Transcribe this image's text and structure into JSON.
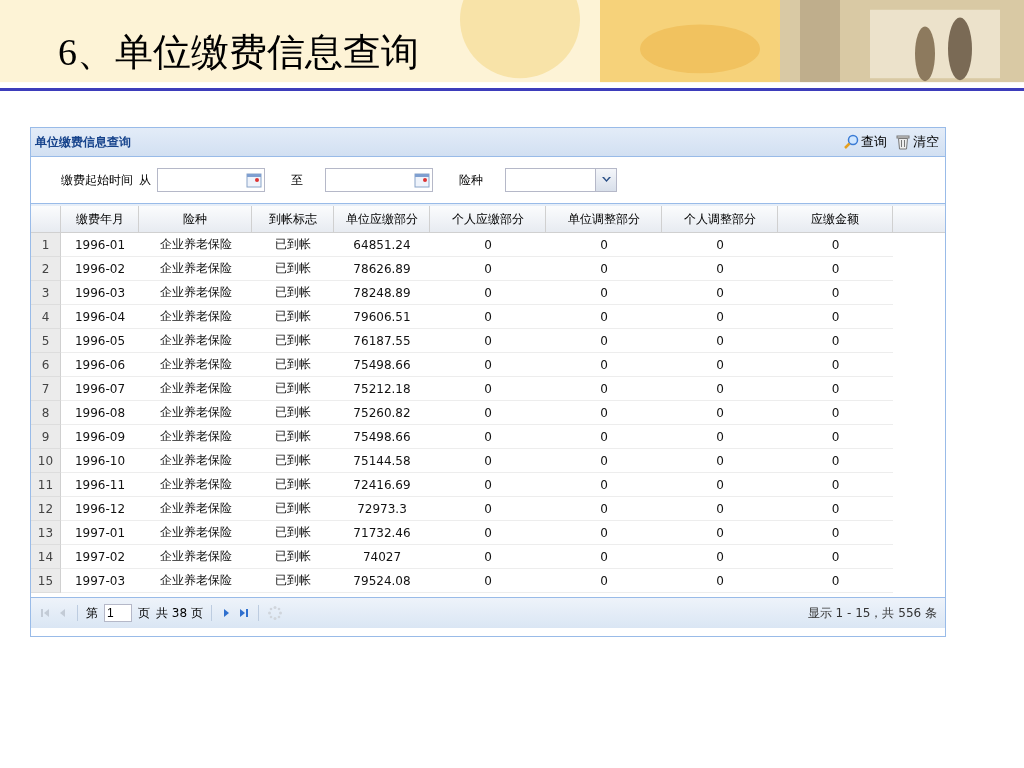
{
  "slide_title": "6、单位缴费信息查询",
  "panel": {
    "title": "单位缴费信息查询",
    "actions": [
      {
        "kind": "search",
        "label": "查询"
      },
      {
        "kind": "clear",
        "label": "清空"
      }
    ]
  },
  "filters": {
    "period_label": "缴费起始时间",
    "from_label": "从",
    "to_label": "至",
    "insurance_label": "险种"
  },
  "table": {
    "columns": [
      "",
      "缴费年月",
      "险种",
      "到帐标志",
      "单位应缴部分",
      "个人应缴部分",
      "单位调整部分",
      "个人调整部分",
      "应缴金额"
    ],
    "rows": [
      [
        "1",
        "1996-01",
        "企业养老保险",
        "已到帐",
        "64851.24",
        "0",
        "0",
        "0",
        "0"
      ],
      [
        "2",
        "1996-02",
        "企业养老保险",
        "已到帐",
        "78626.89",
        "0",
        "0",
        "0",
        "0"
      ],
      [
        "3",
        "1996-03",
        "企业养老保险",
        "已到帐",
        "78248.89",
        "0",
        "0",
        "0",
        "0"
      ],
      [
        "4",
        "1996-04",
        "企业养老保险",
        "已到帐",
        "79606.51",
        "0",
        "0",
        "0",
        "0"
      ],
      [
        "5",
        "1996-05",
        "企业养老保险",
        "已到帐",
        "76187.55",
        "0",
        "0",
        "0",
        "0"
      ],
      [
        "6",
        "1996-06",
        "企业养老保险",
        "已到帐",
        "75498.66",
        "0",
        "0",
        "0",
        "0"
      ],
      [
        "7",
        "1996-07",
        "企业养老保险",
        "已到帐",
        "75212.18",
        "0",
        "0",
        "0",
        "0"
      ],
      [
        "8",
        "1996-08",
        "企业养老保险",
        "已到帐",
        "75260.82",
        "0",
        "0",
        "0",
        "0"
      ],
      [
        "9",
        "1996-09",
        "企业养老保险",
        "已到帐",
        "75498.66",
        "0",
        "0",
        "0",
        "0"
      ],
      [
        "10",
        "1996-10",
        "企业养老保险",
        "已到帐",
        "75144.58",
        "0",
        "0",
        "0",
        "0"
      ],
      [
        "11",
        "1996-11",
        "企业养老保险",
        "已到帐",
        "72416.69",
        "0",
        "0",
        "0",
        "0"
      ],
      [
        "12",
        "1996-12",
        "企业养老保险",
        "已到帐",
        "72973.3",
        "0",
        "0",
        "0",
        "0"
      ],
      [
        "13",
        "1997-01",
        "企业养老保险",
        "已到帐",
        "71732.46",
        "0",
        "0",
        "0",
        "0"
      ],
      [
        "14",
        "1997-02",
        "企业养老保险",
        "已到帐",
        "74027",
        "0",
        "0",
        "0",
        "0"
      ],
      [
        "15",
        "1997-03",
        "企业养老保险",
        "已到帐",
        "79524.08",
        "0",
        "0",
        "0",
        "0"
      ]
    ]
  },
  "pager": {
    "page_prefix": "第",
    "page": "1",
    "page_suffix": "页",
    "total_pages": "共 38 页",
    "summary": "显示 1 - 15，共 556 条"
  }
}
